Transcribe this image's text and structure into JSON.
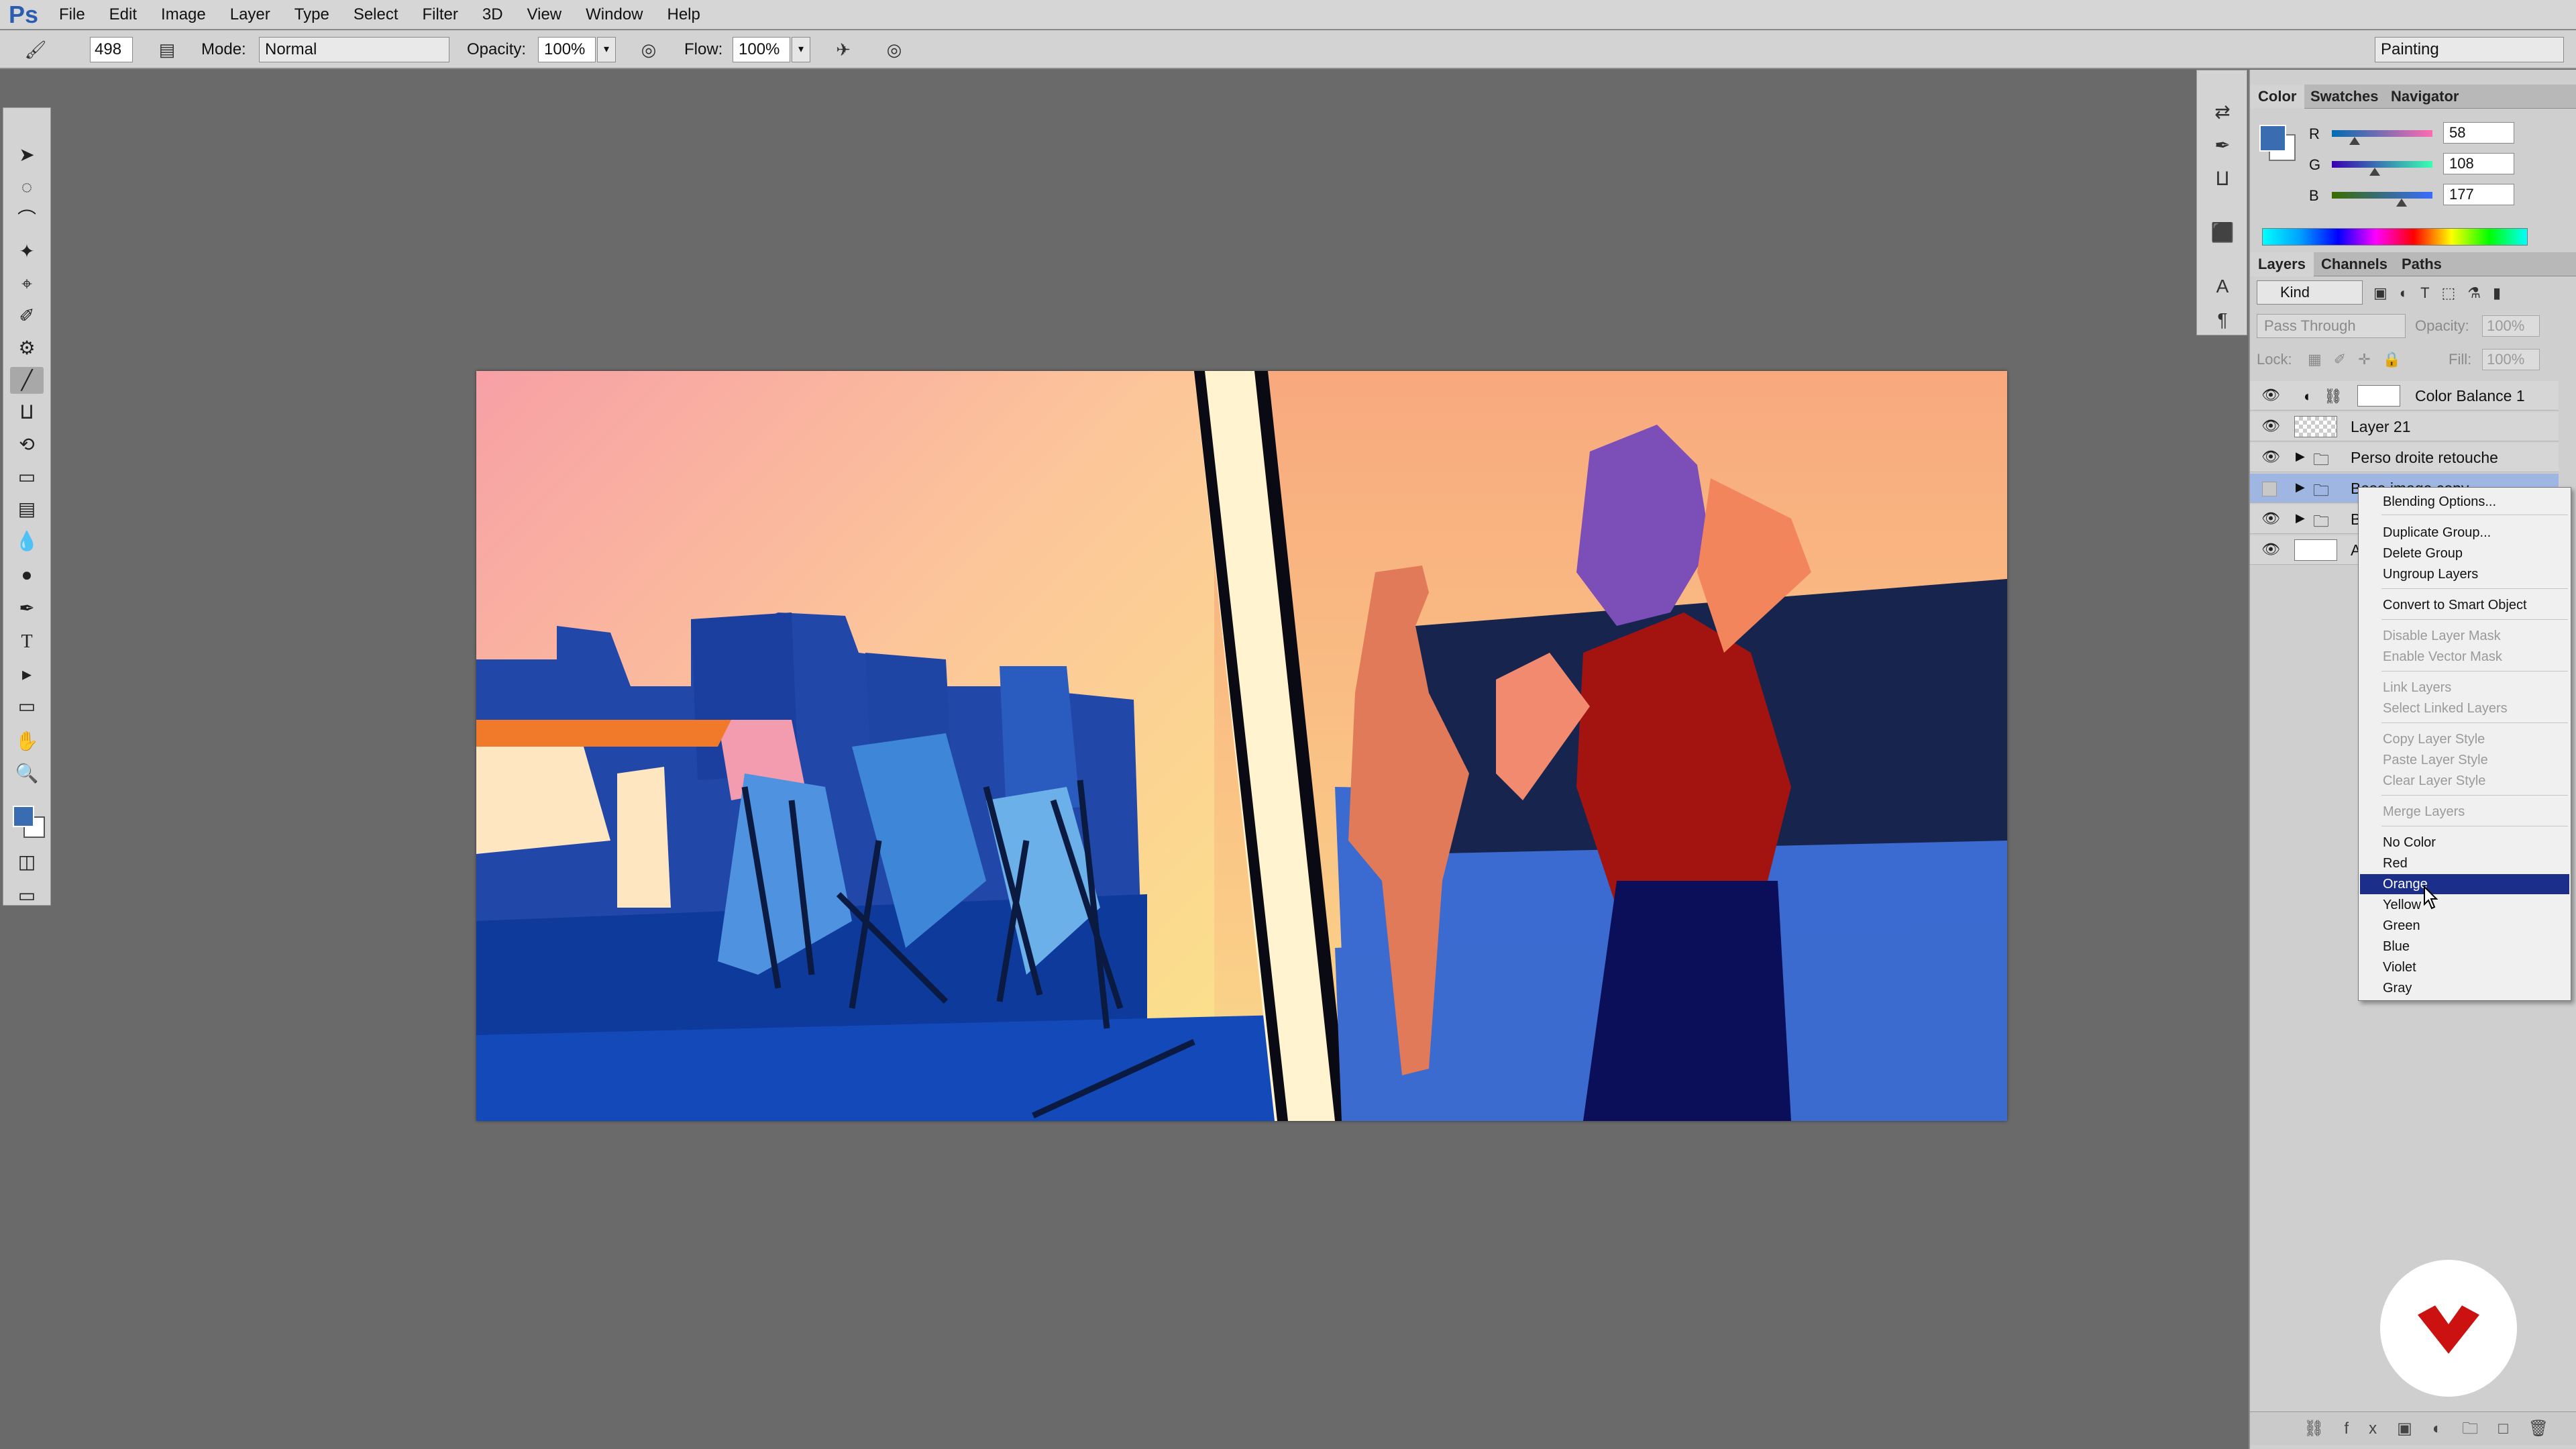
{
  "app": {
    "logo": "Ps"
  },
  "menu": [
    "File",
    "Edit",
    "Image",
    "Layer",
    "Type",
    "Select",
    "Filter",
    "3D",
    "View",
    "Window",
    "Help"
  ],
  "options": {
    "brush_size": "498",
    "mode_label": "Mode:",
    "mode_value": "Normal",
    "opacity_label": "Opacity:",
    "opacity_value": "100%",
    "flow_label": "Flow:",
    "flow_value": "100%",
    "workspace": "Painting"
  },
  "color_panel": {
    "tabs": [
      "Color",
      "Swatches",
      "Navigator"
    ],
    "r_label": "R",
    "r_value": "58",
    "g_label": "G",
    "g_value": "108",
    "b_label": "B",
    "b_value": "177",
    "foreground": "#3a6cb1",
    "r_level": 0.227,
    "g_level": 0.424,
    "b_level": 0.694
  },
  "layers_panel": {
    "tabs": [
      "Layers",
      "Channels",
      "Paths"
    ],
    "filter_kind": "Kind",
    "blend_mode": "Pass Through",
    "opacity_label": "Opacity:",
    "opacity_value": "100%",
    "lock_label": "Lock:",
    "fill_label": "Fill:",
    "fill_value": "100%",
    "layers": [
      {
        "name": "Color Balance 1"
      },
      {
        "name": "Layer 21"
      },
      {
        "name": "Perso droite retouche"
      },
      {
        "name": "Base image copy"
      },
      {
        "name": "B"
      },
      {
        "name": "A"
      }
    ]
  },
  "context_menu": {
    "items": [
      "Blending Options...",
      "Duplicate Group...",
      "Delete Group",
      "Ungroup Layers",
      "Convert to Smart Object",
      "Disable Layer Mask",
      "Enable Vector Mask",
      "Link Layers",
      "Select Linked Layers",
      "Copy Layer Style",
      "Paste Layer Style",
      "Clear Layer Style",
      "Merge Layers",
      "No Color",
      "Red",
      "Orange",
      "Yellow",
      "Green",
      "Blue",
      "Violet",
      "Gray"
    ],
    "selected": "Orange"
  },
  "colors": {
    "accent": "#1b2f8a",
    "badge_red": "#cc1111"
  }
}
